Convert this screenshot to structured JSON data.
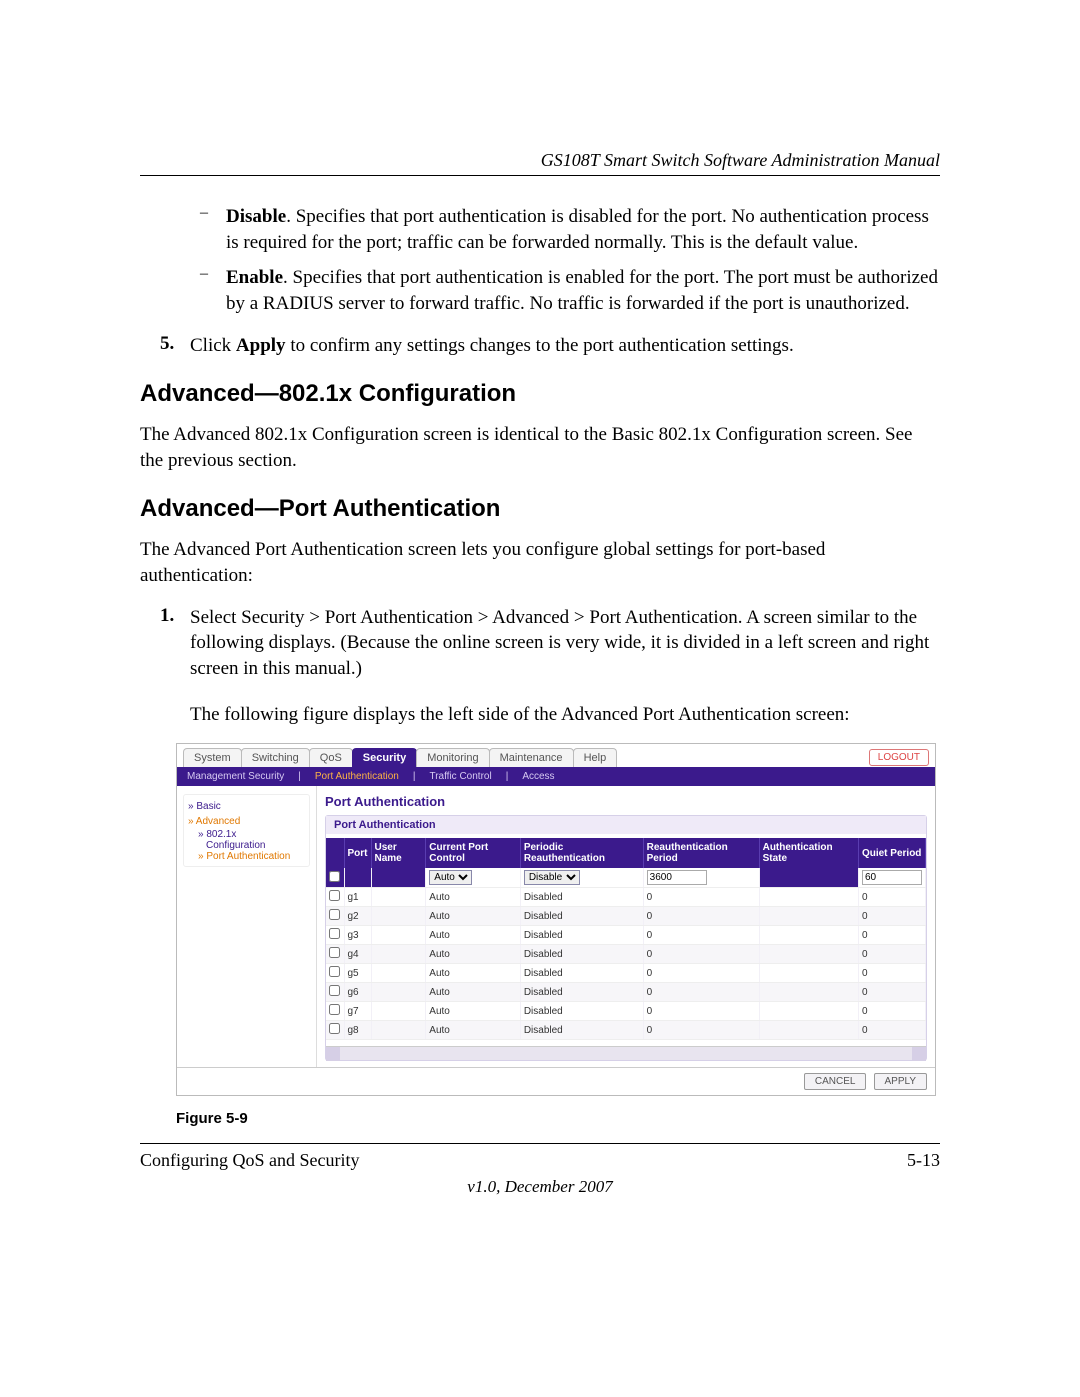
{
  "doc": {
    "header": "GS108T Smart Switch Software Administration Manual",
    "bullets": [
      {
        "lead": "Disable",
        "text": ". Specifies that port authentication is disabled for the port. No authentication process is required for the port; traffic can be forwarded normally. This is the default value."
      },
      {
        "lead": "Enable",
        "text": ". Specifies that port authentication is enabled for the port. The port must be authorized by a RADIUS server to forward traffic. No traffic is forwarded if the port is unauthorized."
      }
    ],
    "step5_pre": "Click ",
    "step5_bold": "Apply",
    "step5_post": " to confirm any settings changes to the port authentication settings.",
    "h1": "Advanced—802.1x Configuration",
    "p1": "The Advanced 802.1x Configuration screen is identical to the Basic 802.1x Configuration screen. See the previous section.",
    "h2": "Advanced—Port Authentication",
    "p2": "The Advanced Port Authentication screen lets you configure global settings for port-based authentication:",
    "step1": "Select Security > Port Authentication > Advanced > Port Authentication. A screen similar to the following displays. (Because the online screen is very wide, it is divided in a left screen and right screen in this manual.)",
    "p3": "The following figure displays the left side of the Advanced Port Authentication screen:",
    "figcap": "Figure 5-9",
    "footer_left": "Configuring QoS and Security",
    "footer_right": "5-13",
    "version": "v1.0, December 2007"
  },
  "ui": {
    "tabs": [
      "System",
      "Switching",
      "QoS",
      "Security",
      "Monitoring",
      "Maintenance",
      "Help"
    ],
    "active_tab": "Security",
    "logout": "LOGOUT",
    "subnav": [
      "Management Security",
      "Port Authentication",
      "Traffic Control",
      "Access"
    ],
    "subnav_active": "Port Authentication",
    "sidebar": {
      "basic": "Basic",
      "advanced": "Advanced",
      "x8021": "802.1x",
      "config": "Configuration",
      "portauth": "Port Authentication"
    },
    "title": "Port Authentication",
    "panel_title": "Port Authentication",
    "columns": [
      "",
      "Port",
      "User Name",
      "Current Port Control",
      "Periodic Reauthentication",
      "Reauthentication Period",
      "Authentication State",
      "Quiet Period"
    ],
    "filter": {
      "port_control": "Auto",
      "periodic": "Disable",
      "reauth": "3600",
      "quiet": "60"
    },
    "rows": [
      {
        "port": "g1",
        "ctrl": "Auto",
        "periodic": "Disabled",
        "reauth": "0",
        "quiet": "0"
      },
      {
        "port": "g2",
        "ctrl": "Auto",
        "periodic": "Disabled",
        "reauth": "0",
        "quiet": "0"
      },
      {
        "port": "g3",
        "ctrl": "Auto",
        "periodic": "Disabled",
        "reauth": "0",
        "quiet": "0"
      },
      {
        "port": "g4",
        "ctrl": "Auto",
        "periodic": "Disabled",
        "reauth": "0",
        "quiet": "0"
      },
      {
        "port": "g5",
        "ctrl": "Auto",
        "periodic": "Disabled",
        "reauth": "0",
        "quiet": "0"
      },
      {
        "port": "g6",
        "ctrl": "Auto",
        "periodic": "Disabled",
        "reauth": "0",
        "quiet": "0"
      },
      {
        "port": "g7",
        "ctrl": "Auto",
        "periodic": "Disabled",
        "reauth": "0",
        "quiet": "0"
      },
      {
        "port": "g8",
        "ctrl": "Auto",
        "periodic": "Disabled",
        "reauth": "0",
        "quiet": "0"
      }
    ],
    "buttons": {
      "cancel": "CANCEL",
      "apply": "APPLY"
    }
  }
}
